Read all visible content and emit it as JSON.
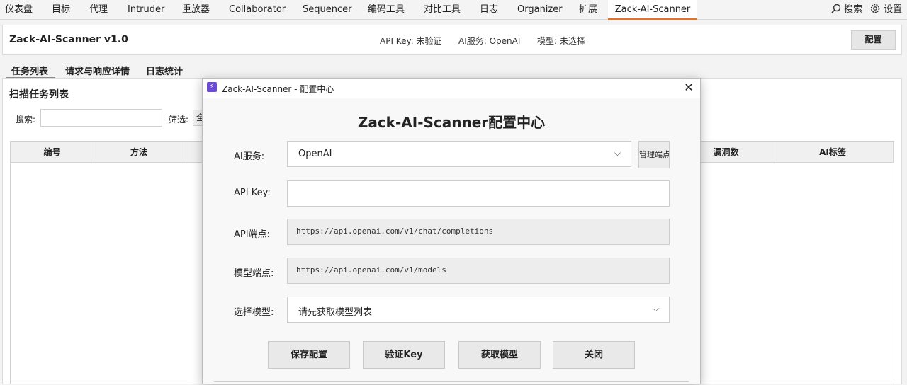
{
  "menubar": {
    "items": [
      "仪表盘",
      "目标",
      "代理",
      "Intruder",
      "重放器",
      "Collaborator",
      "Sequencer",
      "编码工具",
      "对比工具",
      "日志",
      "Organizer",
      "扩展",
      "Zack-AI-Scanner"
    ],
    "search_label": "搜索",
    "settings_label": "设置",
    "accent": "#e8702a"
  },
  "header": {
    "title": "Zack-AI-Scanner v1.0",
    "api_key_status": "API Key: 未验证",
    "ai_service_status": "AI服务: OpenAI",
    "model_status": "模型: 未选择",
    "config_label": "配置"
  },
  "tabs": [
    "任务列表",
    "请求与响应详情",
    "日志统计"
  ],
  "task_panel": {
    "title": "扫描任务列表",
    "search_label": "搜索:",
    "search_value": "",
    "filter_label": "筛选:",
    "filter_value": "全",
    "columns": [
      "编号",
      "方法",
      "",
      "",
      "",
      "",
      "",
      "漏洞数",
      "AI标签"
    ]
  },
  "dialog": {
    "window_title": "Zack-AI-Scanner - 配置中心",
    "heading": "Zack-AI-Scanner配置中心",
    "fields": {
      "ai_service": {
        "label": "AI服务:",
        "value": "OpenAI"
      },
      "api_key": {
        "label": "API Key:",
        "value": ""
      },
      "api_endpoint": {
        "label": "API端点:",
        "value": "https://api.openai.com/v1/chat/completions"
      },
      "model_endpoint": {
        "label": "模型端点:",
        "value": "https://api.openai.com/v1/models"
      },
      "model": {
        "label": "选择模型:",
        "value": "请先获取模型列表"
      }
    },
    "manage_label": "管理端点",
    "buttons": {
      "save": "保存配置",
      "verify": "验证Key",
      "fetch": "获取模型",
      "close": "关闭"
    },
    "icon_color": "#6b4bd6"
  }
}
